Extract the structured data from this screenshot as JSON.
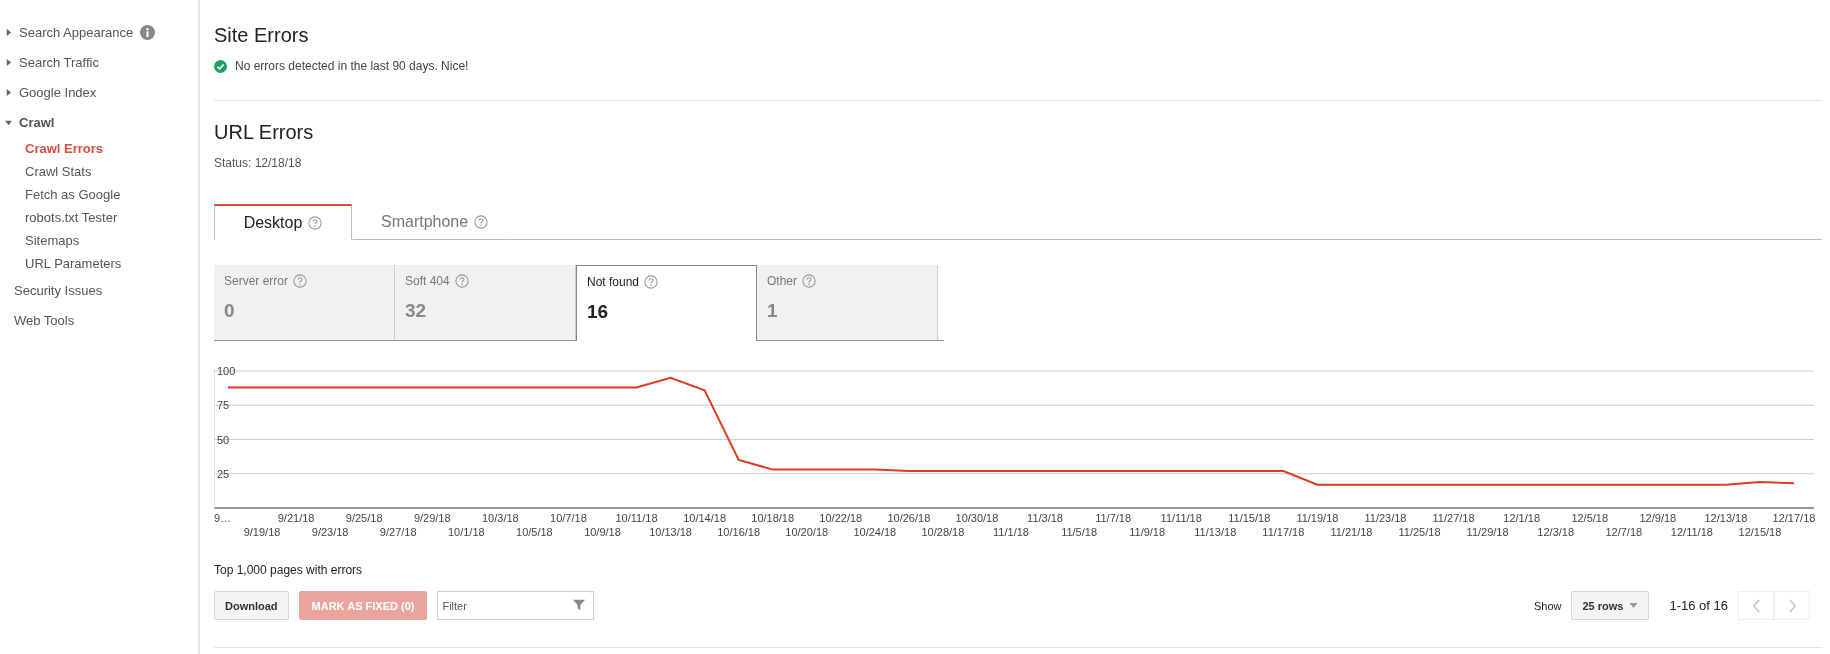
{
  "sidebar": {
    "items": [
      {
        "kind": "group",
        "label": "Search Appearance",
        "expanded": false,
        "info": true
      },
      {
        "kind": "group",
        "label": "Search Traffic",
        "expanded": false
      },
      {
        "kind": "group",
        "label": "Google Index",
        "expanded": false
      },
      {
        "kind": "group",
        "label": "Crawl",
        "expanded": true,
        "children": [
          {
            "label": "Crawl Errors",
            "selected": true
          },
          {
            "label": "Crawl Stats",
            "selected": false
          },
          {
            "label": "Fetch as Google",
            "selected": false
          },
          {
            "label": "robots.txt Tester",
            "selected": false
          },
          {
            "label": "Sitemaps",
            "selected": false
          },
          {
            "label": "URL Parameters",
            "selected": false
          }
        ]
      },
      {
        "kind": "link",
        "label": "Security Issues"
      },
      {
        "kind": "link",
        "label": "Web Tools"
      }
    ]
  },
  "site_errors": {
    "title": "Site Errors",
    "message": "No errors detected in the last 90 days. Nice!"
  },
  "url_errors": {
    "title": "URL Errors",
    "status": "Status: 12/18/18",
    "tabs": [
      {
        "label": "Desktop",
        "selected": true
      },
      {
        "label": "Smartphone",
        "selected": false
      }
    ],
    "cards": [
      {
        "label": "Server error",
        "value": "0",
        "selected": false
      },
      {
        "label": "Soft 404",
        "value": "32",
        "selected": false
      },
      {
        "label": "Not found",
        "value": "16",
        "selected": true
      },
      {
        "label": "Other",
        "value": "1",
        "selected": false
      }
    ],
    "chart_data": {
      "type": "line",
      "grid": true,
      "yticks": [
        25,
        50,
        75,
        100
      ],
      "ylim": [
        0,
        100
      ],
      "categories": [
        "9…",
        "9/19/18",
        "9/21/18",
        "9/23/18",
        "9/25/18",
        "9/27/18",
        "9/29/18",
        "10/1/18",
        "10/3/18",
        "10/5/18",
        "10/7/18",
        "10/9/18",
        "10/11/18",
        "10/13/18",
        "10/14/18",
        "10/16/18",
        "10/18/18",
        "10/20/18",
        "10/22/18",
        "10/24/18",
        "10/26/18",
        "10/28/18",
        "10/30/18",
        "11/1/18",
        "11/3/18",
        "11/5/18",
        "11/7/18",
        "11/9/18",
        "11/11/18",
        "11/13/18",
        "11/15/18",
        "11/17/18",
        "11/19/18",
        "11/21/18",
        "11/23/18",
        "11/25/18",
        "11/27/18",
        "11/29/18",
        "12/1/18",
        "12/3/18",
        "12/5/18",
        "12/7/18",
        "12/9/18",
        "12/11/18",
        "12/13/18",
        "12/15/18",
        "12/17/18"
      ],
      "series": [
        {
          "color": "#dd3b1f",
          "values": [
            88,
            88,
            88,
            88,
            88,
            88,
            88,
            88,
            88,
            88,
            88,
            88,
            88,
            95,
            86,
            35,
            28,
            28,
            28,
            28,
            27,
            27,
            27,
            27,
            27,
            27,
            27,
            27,
            27,
            27,
            27,
            27,
            17,
            17,
            17,
            17,
            17,
            17,
            17,
            17,
            17,
            17,
            17,
            17,
            17,
            19,
            18
          ]
        }
      ]
    }
  },
  "pages": {
    "title": "Top 1,000 pages with errors",
    "download": {
      "label": "Download"
    },
    "mark_fixed": {
      "label": "MARK AS FIXED (0)",
      "disabled": true
    },
    "filter": {
      "placeholder": "Filter"
    },
    "show_label": "Show",
    "rows_select": "25 rows",
    "range": "1-16 of 16",
    "prev": {
      "disabled": true
    },
    "next": {
      "disabled": true
    }
  }
}
